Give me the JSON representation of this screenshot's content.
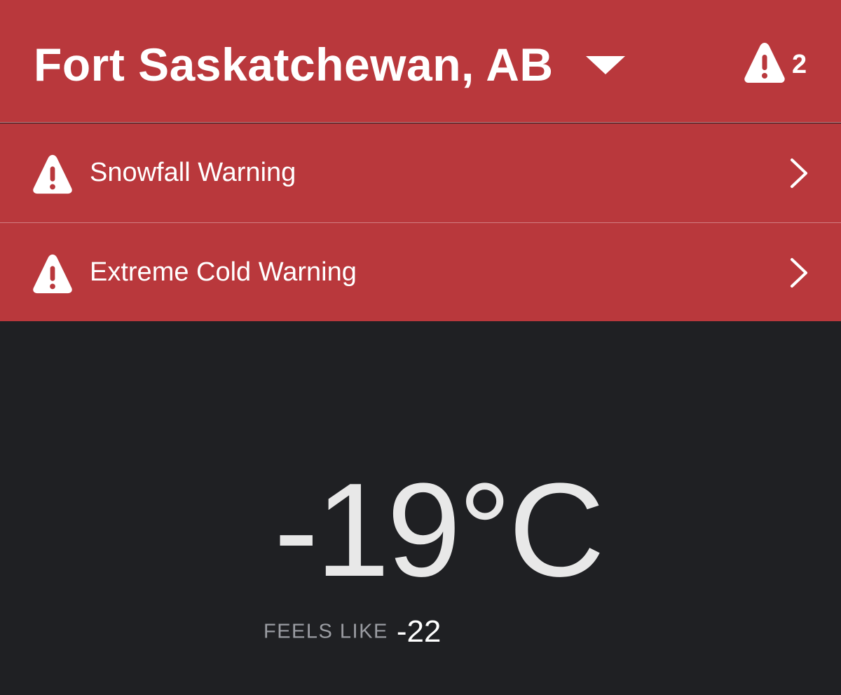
{
  "header": {
    "location": "Fort Saskatchewan, AB",
    "alert_count": "2"
  },
  "alerts": [
    {
      "label": "Snowfall Warning"
    },
    {
      "label": "Extreme Cold Warning"
    }
  ],
  "current": {
    "temperature": "-19°C",
    "feels_like_label": "FEELS LIKE",
    "feels_like_value": "-22"
  },
  "colors": {
    "alert_red": "#b9383c",
    "background_dark": "#1f2023",
    "text_white": "#ffffff",
    "text_muted": "#9a9ca2"
  },
  "icons": {
    "dropdown": "chevron-down-icon",
    "alerts": "warning-triangle-icon",
    "row_arrow": "chevron-right-icon"
  }
}
